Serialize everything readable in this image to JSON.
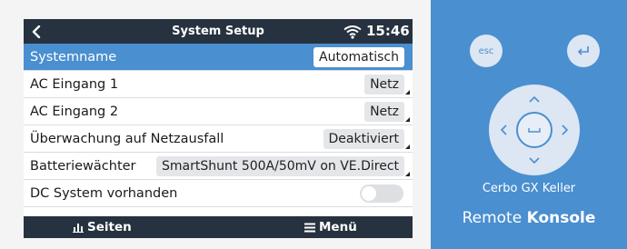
{
  "header": {
    "title": "System Setup",
    "time": "15:46"
  },
  "rows": [
    {
      "label": "Systemname",
      "value": "Automatisch"
    },
    {
      "label": "AC Eingang 1",
      "value": "Netz"
    },
    {
      "label": "AC Eingang 2",
      "value": "Netz"
    },
    {
      "label": "Überwachung auf Netzausfall",
      "value": "Deaktiviert"
    },
    {
      "label": "Batteriewächter",
      "value": "SmartShunt 500A/50mV on VE.Direct"
    },
    {
      "label": "DC System vorhanden",
      "toggle": false
    }
  ],
  "footer": {
    "pages_label": "Seiten",
    "menu_label": "Menü"
  },
  "remote": {
    "esc_label": "esc",
    "device_name": "Cerbo GX Keller",
    "brand_light": "Remote",
    "brand_bold": "Konsole"
  },
  "colors": {
    "accent": "#4a8fd0",
    "header_bg": "#26323f",
    "frame_bg": "#f4f4f4",
    "value_chip": "#e4e6e9"
  },
  "icons": [
    "back-chevron-icon",
    "wifi-icon",
    "bar-chart-icon",
    "hamburger-menu-icon",
    "enter-return-icon",
    "dpad-arrow-icons",
    "space-bar-icon"
  ]
}
